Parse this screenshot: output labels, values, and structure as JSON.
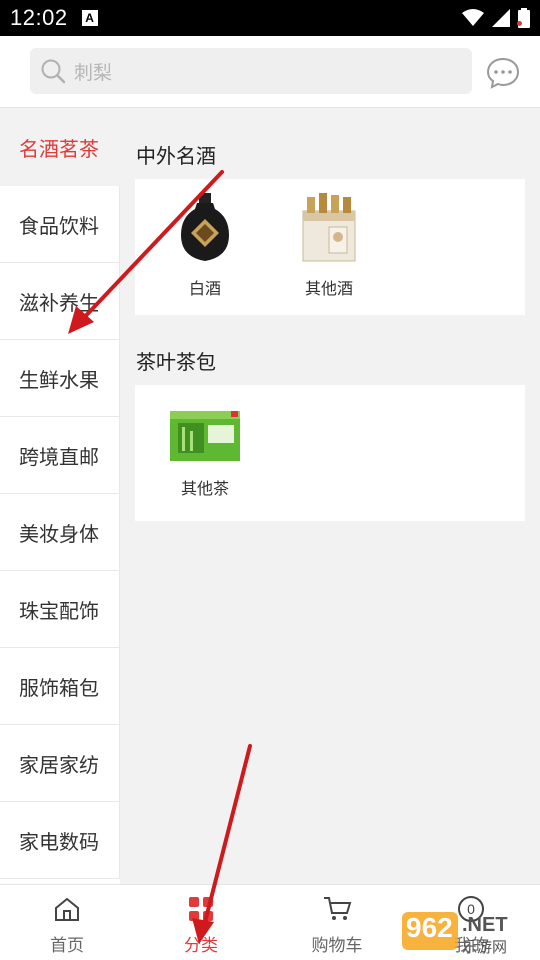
{
  "status_bar": {
    "time": "12:02",
    "a_badge": "A"
  },
  "search": {
    "placeholder": "刺梨",
    "icon": "search-icon"
  },
  "header": {
    "message_icon": "chat-bubble-icon"
  },
  "sidebar": {
    "items": [
      {
        "label": "名酒茗茶",
        "active": true
      },
      {
        "label": "食品饮料"
      },
      {
        "label": "滋补养生"
      },
      {
        "label": "生鲜水果"
      },
      {
        "label": "跨境直邮"
      },
      {
        "label": "美妆身体"
      },
      {
        "label": "珠宝配饰"
      },
      {
        "label": "服饰箱包"
      },
      {
        "label": "家居家纺"
      },
      {
        "label": "家电数码"
      }
    ]
  },
  "content": {
    "sections": [
      {
        "title": "中外名酒",
        "products": [
          {
            "label": "白酒",
            "image": "baijiu-bottle"
          },
          {
            "label": "其他酒",
            "image": "wine-gift-box"
          }
        ]
      },
      {
        "title": "茶叶茶包",
        "products": [
          {
            "label": "其他茶",
            "image": "green-tea-box"
          }
        ]
      }
    ]
  },
  "bottom_nav": {
    "items": [
      {
        "label": "首页",
        "icon": "home-icon"
      },
      {
        "label": "分类",
        "icon": "category-grid-icon",
        "active": true
      },
      {
        "label": "购物车",
        "icon": "cart-icon"
      },
      {
        "label": "我的",
        "icon": "user-icon",
        "badge": "0"
      }
    ]
  },
  "watermark": {
    "number": "962",
    "suffix": ".NET",
    "sub": "乐游网"
  },
  "colors": {
    "accent": "#e03a3a",
    "annotation_arrow": "#d0191c"
  }
}
